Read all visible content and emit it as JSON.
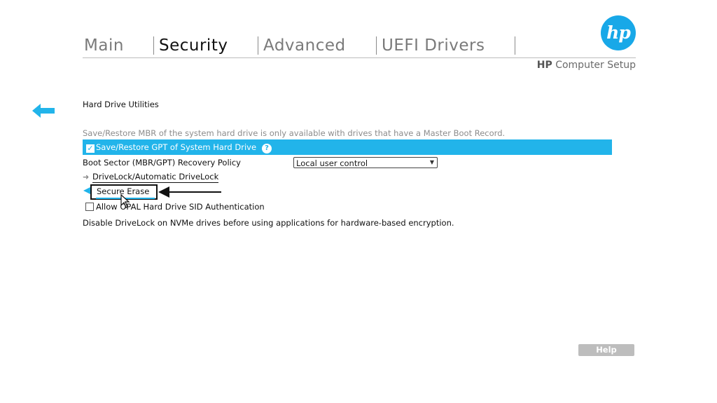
{
  "tabs": [
    {
      "label": "Main"
    },
    {
      "label": "Security"
    },
    {
      "label": "Advanced"
    },
    {
      "label": "UEFI Drivers"
    }
  ],
  "brand": {
    "logo_text": "hp",
    "product_bold": "HP",
    "product_rest": "Computer Setup",
    "accent": "#22b4ea"
  },
  "page": {
    "section_title": "Hard Drive Utilities",
    "note": "Save/Restore MBR of the system hard drive is only available with drives that have a Master Boot Record.",
    "gpt_option": {
      "label": "Save/Restore GPT of System Hard Drive",
      "checked": true,
      "help_icon": "?"
    },
    "boot_sector": {
      "label": "Boot Sector (MBR/GPT) Recovery Policy",
      "value": "Local user control"
    },
    "drivelock": {
      "label": "DriveLock/Automatic DriveLock"
    },
    "secure_erase": {
      "label": "Secure Erase"
    },
    "opal": {
      "label": "Allow OPAL Hard Drive SID Authentication",
      "checked": false
    },
    "footer_note": "Disable DriveLock on NVMe drives before using applications for hardware-based encryption."
  },
  "buttons": {
    "help": "Help"
  },
  "icons": {
    "back": "back-arrow-icon",
    "cursor": "mouse-cursor-icon",
    "annotation": "annotation-arrow-icon"
  }
}
